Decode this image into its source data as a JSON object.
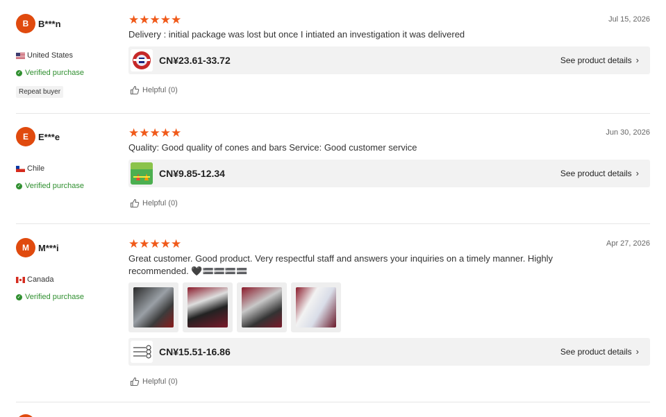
{
  "common": {
    "helpful_label": "Helpful (0)",
    "see_details_label": "See product details",
    "verified_label": "Verified purchase",
    "stars_text": "★★★★★",
    "chevron": "›",
    "accent_color": "#e04a0e",
    "star_color": "#f05a1a",
    "verified_color": "#2f8f2f"
  },
  "reviews": [
    {
      "avatar_letter": "B",
      "username": "B***n",
      "country": "United States",
      "flag_icon": "us-flag-icon",
      "badge": "Repeat buyer",
      "rating": 5,
      "date": "Jul 15, 2026",
      "text": "Delivery : initial package was lost but once I intiated an investigation it was delivered",
      "price": "CN¥23.61-33.72",
      "helpful_count": 0
    },
    {
      "avatar_letter": "E",
      "username": "E***e",
      "country": "Chile",
      "flag_icon": "chile-flag-icon",
      "rating": 5,
      "date": "Jun 30, 2026",
      "text": "Quality: Good quality of cones and bars Service: Good customer service",
      "price": "CN¥9.85-12.34",
      "helpful_count": 0
    },
    {
      "avatar_letter": "M",
      "username": "M***i",
      "country": "Canada",
      "flag_icon": "canada-flag-icon",
      "rating": 5,
      "date": "Apr 27, 2026",
      "text": "Great customer. Good product. Very respectful staff and answers your inquiries on a timely manner. Highly recommended. 🖤🟰🟰🟰🟰",
      "photos_count": 4,
      "price": "CN¥15.51-16.86",
      "helpful_count": 0
    }
  ]
}
